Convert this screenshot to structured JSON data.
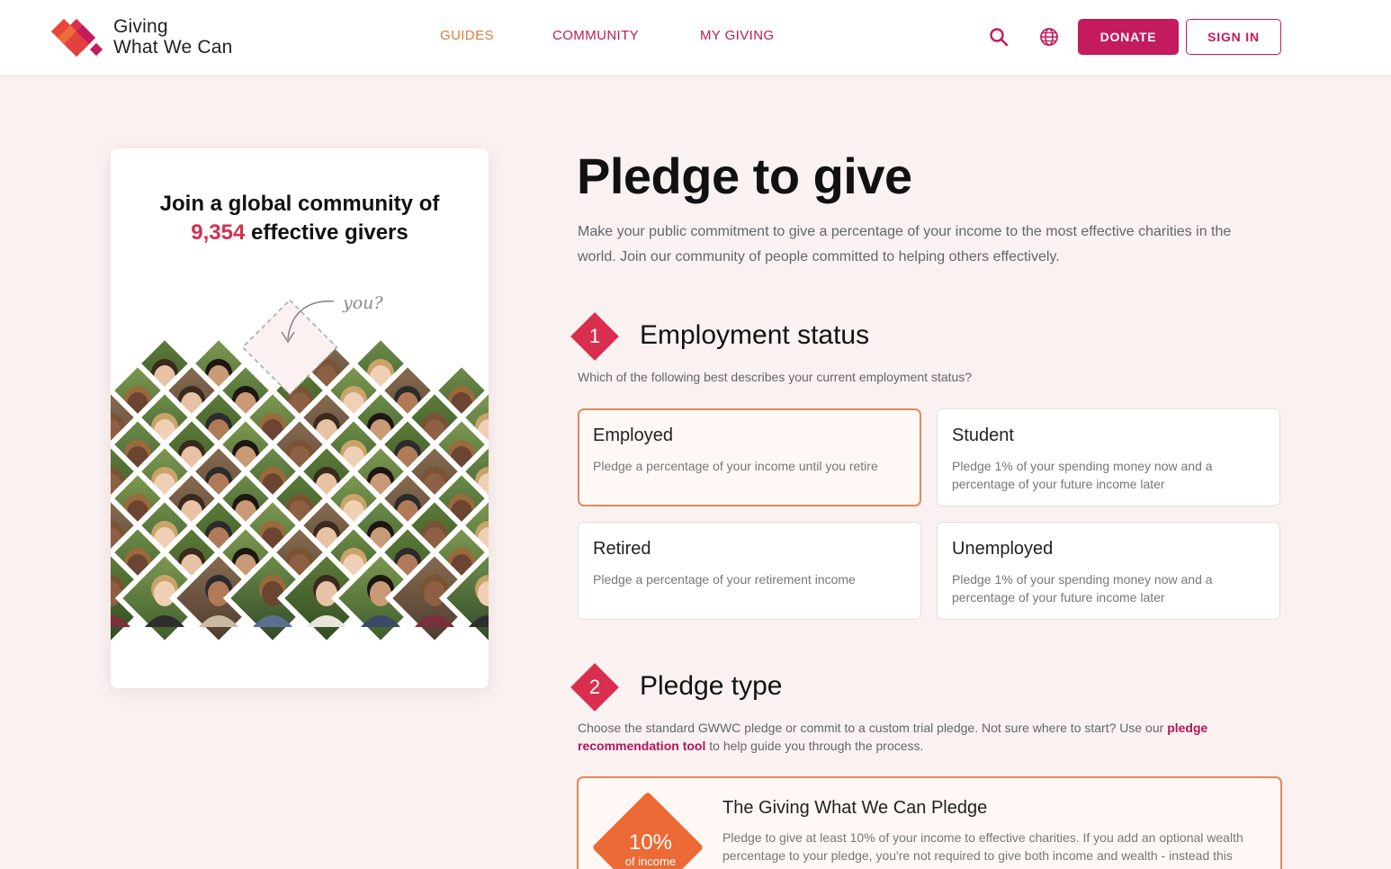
{
  "header": {
    "logo_line1": "Giving",
    "logo_line2": "What We Can",
    "nav": {
      "guides": "GUIDES",
      "community": "COMMUNITY",
      "my_giving": "MY GIVING"
    },
    "donate_label": "DONATE",
    "signin_label": "SIGN IN",
    "icons": [
      "search-icon",
      "globe-icon"
    ]
  },
  "colors": {
    "brand": "#c41a5e",
    "accent": "#e07a3e",
    "badge": "#d92e4e",
    "background": "#faf1f1"
  },
  "card": {
    "title_line1": "Join a global community of",
    "count": "9,354",
    "title_line2_rest": "effective givers",
    "you_label": "you?"
  },
  "main": {
    "title": "Pledge to give",
    "lead": "Make your public commitment to give a percentage of your income to the most effective charities in the world. Join our community of people committed to helping others effectively.",
    "step1": {
      "number": "1",
      "title": "Employment status",
      "desc": "Which of the following best describes your current employment status?",
      "options": [
        {
          "title": "Employed",
          "desc": "Pledge a percentage of your income until you retire"
        },
        {
          "title": "Student",
          "desc": "Pledge 1% of your spending money now and a percentage of your future income later"
        },
        {
          "title": "Retired",
          "desc": "Pledge a percentage of your retirement income"
        },
        {
          "title": "Unemployed",
          "desc": "Pledge 1% of your spending money now and a percentage of your future income later"
        }
      ],
      "selected": "Employed"
    },
    "step2": {
      "number": "2",
      "title": "Pledge type",
      "desc_before": "Choose the standard GWWC pledge or commit to a custom trial pledge. Not sure where to start? Use our ",
      "desc_link": "pledge recommendation tool",
      "desc_after": " to help guide you through the process.",
      "pledge": {
        "percent": "10%",
        "percent_sub": "of income",
        "title": "The Giving What We Can Pledge",
        "desc": "Pledge to give at least 10% of your income to effective charities. If you add an optional wealth percentage to your pledge, you're not required to give both income and wealth - instead this means you might give to either."
      }
    }
  }
}
